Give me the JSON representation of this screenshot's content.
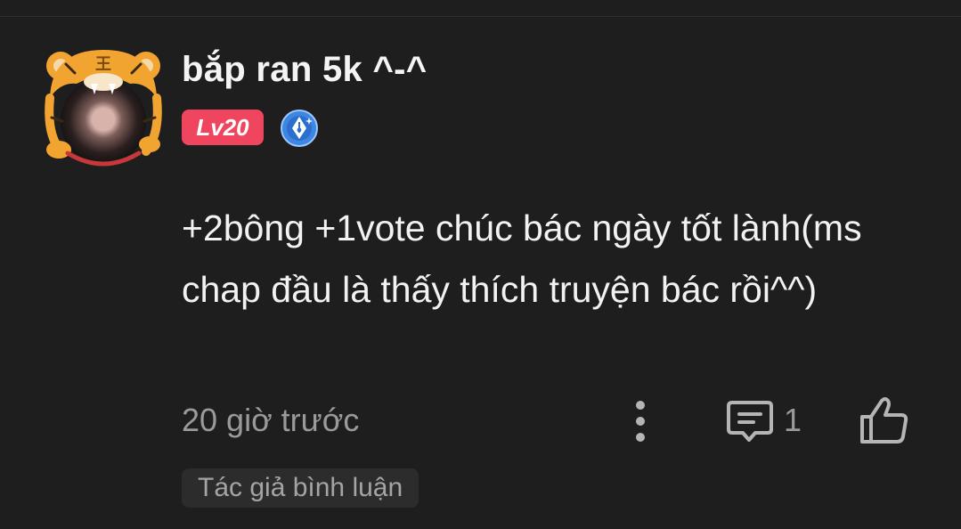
{
  "comment": {
    "username": "bắp ran 5k ^-^",
    "level": "Lv20",
    "body": "+2bông +1vote chúc bác ngày tốt lành(ms chap đầu là thấy thích truyện bác rồi^^)",
    "timestamp": "20 giờ trước",
    "reply_count": "1",
    "author_tag": "Tác giả bình luận"
  },
  "icons": {
    "avatar_frame": "tiger-head-frame",
    "avatar_frame_char": "王",
    "badge": "pen-nib-badge",
    "more": "more-vertical-icon",
    "reply": "comment-bubble-icon",
    "like": "thumbs-up-icon"
  },
  "colors": {
    "background": "#1e1e1e",
    "level_badge": "#f0455e",
    "tiger_orange": "#f2a431",
    "pen_badge_blue": "#3d86e3",
    "muted_text": "#9a9a9a"
  }
}
